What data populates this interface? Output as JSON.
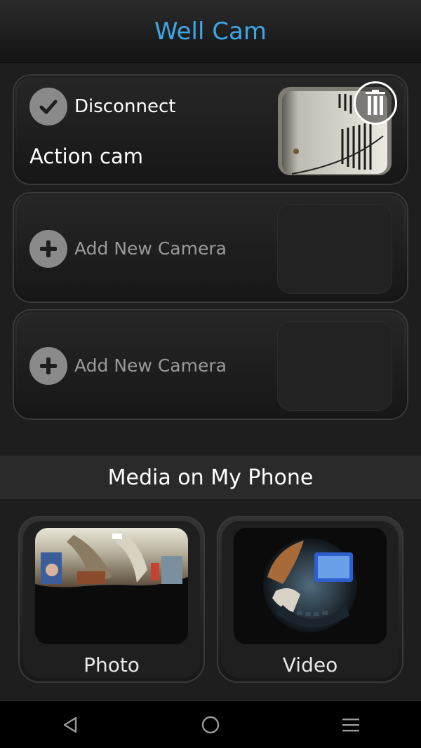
{
  "app": {
    "title": "Well Cam",
    "accent_color": "#3ea6e6"
  },
  "cameras": [
    {
      "status_label": "Disconnect",
      "status_icon": "check-icon",
      "name": "Action cam",
      "has_thumbnail": true,
      "action_icon": "trash-icon"
    },
    {
      "status_label": "Add New Camera",
      "status_icon": "plus-icon"
    },
    {
      "status_label": "Add New Camera",
      "status_icon": "plus-icon"
    }
  ],
  "media": {
    "title": "Media on My Phone",
    "items": [
      {
        "label": "Photo",
        "thumb": "panorama-thumbnail"
      },
      {
        "label": "Video",
        "thumb": "fisheye-thumbnail"
      }
    ]
  },
  "nav": {
    "buttons": [
      "back-icon",
      "home-icon",
      "menu-icon"
    ]
  }
}
